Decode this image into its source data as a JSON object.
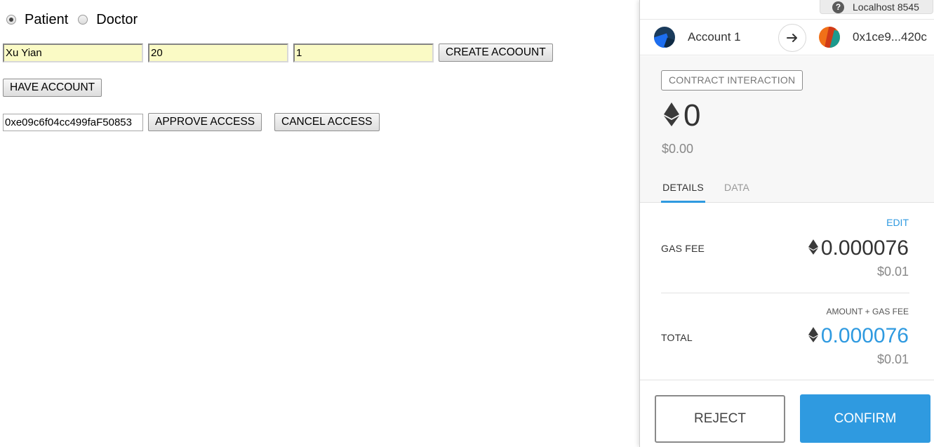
{
  "dapp": {
    "roles": [
      {
        "label": "Patient",
        "checked": true
      },
      {
        "label": "Doctor",
        "checked": false
      }
    ],
    "create_form": {
      "name_value": "Xu Yian",
      "age_value": "20",
      "third_value": "1",
      "create_label": "CREATE ACOOUNT"
    },
    "have_account_label": "HAVE ACCOUNT",
    "access": {
      "address_value": "0xe09c6f04cc499faF50853",
      "approve_label": "APPROVE ACCESS",
      "cancel_label": "CANCEL ACCESS"
    }
  },
  "metamask": {
    "network": "Localhost 8545",
    "help_icon": "?",
    "from_account": "Account 1",
    "to_address": "0x1ce9...420c",
    "badge": "CONTRACT INTERACTION",
    "amount": "0",
    "amount_fiat": "$0.00",
    "tabs": {
      "details": "DETAILS",
      "data": "DATA"
    },
    "edit_label": "EDIT",
    "gas_fee": {
      "label": "GAS FEE",
      "eth": "0.000076",
      "fiat": "$0.01"
    },
    "total": {
      "sub_heading": "AMOUNT + GAS FEE",
      "label": "TOTAL",
      "eth": "0.000076",
      "fiat": "$0.01"
    },
    "reject_label": "REJECT",
    "confirm_label": "CONFIRM",
    "colors": {
      "accent": "#2f9ae0",
      "input_highlight": "#fafac5"
    }
  }
}
